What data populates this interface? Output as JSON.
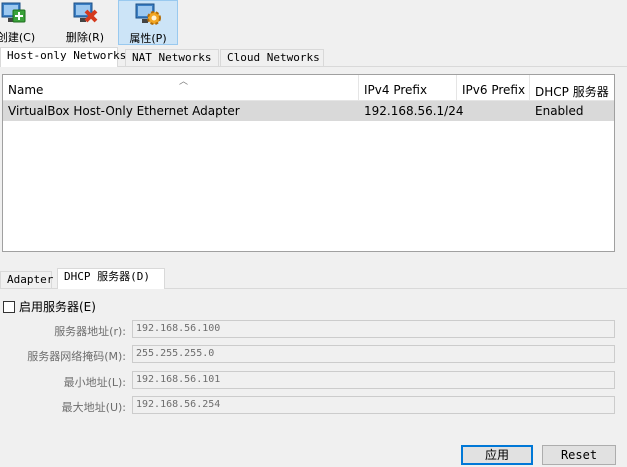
{
  "toolbar": {
    "create_label": "创建(C)",
    "delete_label": "删除(R)",
    "properties_label": "属性(P)"
  },
  "top_tabs": [
    "Host-only Networks",
    "NAT Networks",
    "Cloud Networks"
  ],
  "table": {
    "columns": [
      "Name",
      "IPv4 Prefix",
      "IPv6 Prefix",
      "DHCP 服务器"
    ],
    "rows": [
      {
        "name": "VirtualBox Host-Only Ethernet Adapter",
        "ipv4": "192.168.56.1/24",
        "ipv6": "",
        "dhcp": "Enabled"
      }
    ]
  },
  "bottom_tabs": [
    "Adapter",
    "DHCP 服务器(D)"
  ],
  "dhcp": {
    "enable_label": "启用服务器(E)",
    "enabled": false,
    "fields": [
      {
        "label": "服务器地址(r):",
        "value": "192.168.56.100"
      },
      {
        "label": "服务器网络掩码(M):",
        "value": "255.255.255.0"
      },
      {
        "label": "最小地址(L):",
        "value": "192.168.56.101"
      },
      {
        "label": "最大地址(U):",
        "value": "192.168.56.254"
      }
    ]
  },
  "buttons": {
    "apply_label": "应用",
    "reset_label": "Reset"
  }
}
